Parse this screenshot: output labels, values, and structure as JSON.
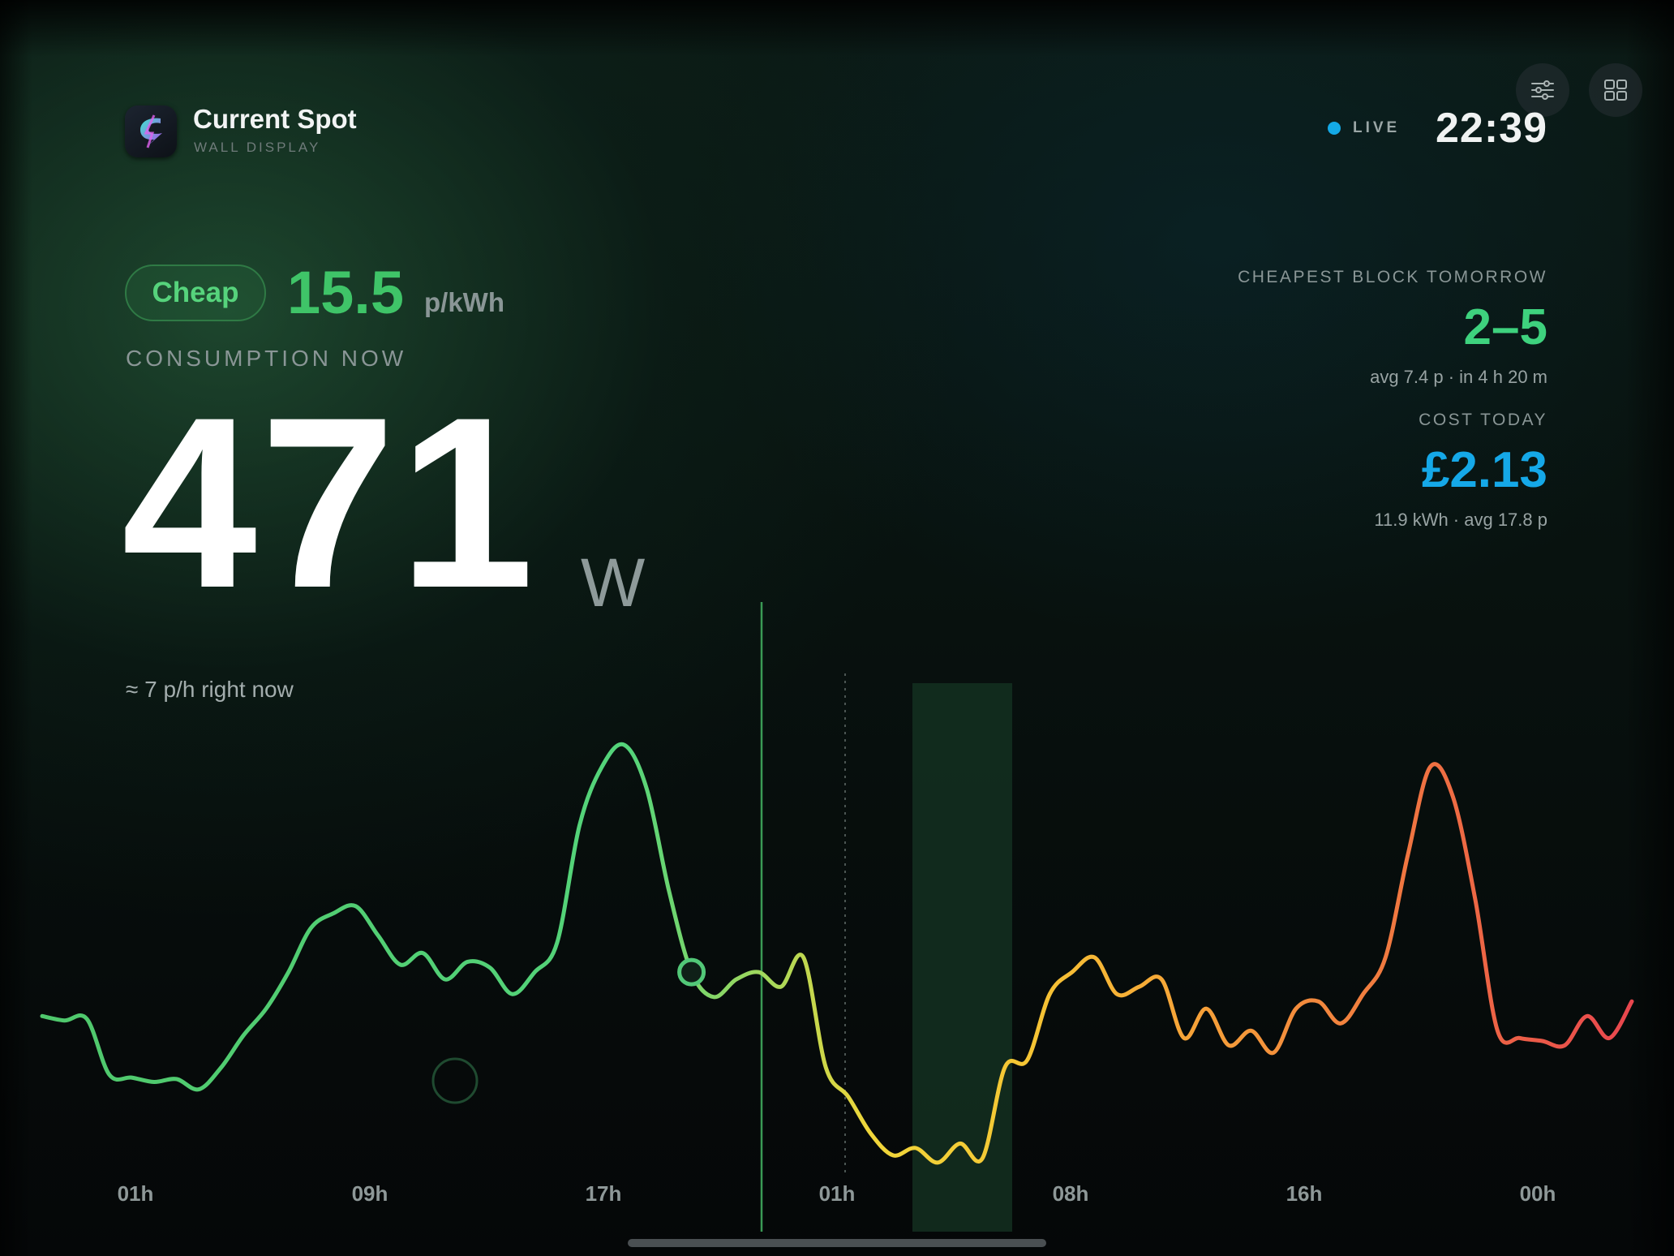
{
  "app": {
    "title": "Current Spot",
    "subtitle": "WALL DISPLAY",
    "icon": "bolt-app-icon"
  },
  "header": {
    "live_label": "LIVE",
    "live_color": "#14a9e6",
    "clock": "22:39",
    "buttons": [
      "sliders-icon",
      "grid-icon"
    ]
  },
  "price_now": {
    "badge": "Cheap",
    "value": "15.5",
    "unit": "p/kWh",
    "color": "#3fc468"
  },
  "consumption": {
    "label": "CONSUMPTION NOW",
    "value": "471",
    "unit": "W",
    "rate_text": "≈ 7 p/h right now"
  },
  "cheapest_block": {
    "label": "CHEAPEST BLOCK TOMORROW",
    "value": "2–5",
    "detail": "avg 7.4 p · in 4 h 20 m",
    "color": "#3ed27e"
  },
  "cost_today": {
    "label": "COST TODAY",
    "value": "£2.13",
    "detail": "11.9 kWh · avg 17.8 p",
    "color": "#15a8e8"
  },
  "chart_data": {
    "type": "line",
    "x_tick_labels": [
      "01h",
      "09h",
      "17h",
      "01h",
      "08h",
      "16h",
      "00h"
    ],
    "series": [
      {
        "values": [
          11.5,
          11.2,
          11.3,
          7.5,
          7.3,
          7.0,
          7.2,
          6.5,
          8.0,
          10.2,
          12.0,
          14.5,
          17.5,
          18.5,
          19.0,
          17.0,
          15.0,
          15.8,
          14.0,
          15.2,
          14.8,
          13.0,
          14.5,
          16.5,
          24.5,
          28.5,
          30.0,
          27.0,
          20.0,
          14.5,
          12.8,
          14.0,
          14.5,
          13.5,
          15.5,
          8.0,
          6.0,
          3.5,
          2.0,
          2.5,
          1.5,
          2.8,
          1.8,
          8.0,
          8.5,
          13.0,
          14.5,
          15.5,
          13.0,
          13.5,
          14.0,
          10.0,
          12.0,
          9.5,
          10.5,
          9.0,
          12.0,
          12.5,
          11.0,
          13.0,
          15.5,
          22.5,
          28.5,
          26.5,
          19.5,
          10.5,
          10.0,
          9.8,
          9.5,
          11.5,
          10.0,
          12.5
        ]
      }
    ],
    "current_index": 29,
    "highlight_block_label": "2–5"
  }
}
